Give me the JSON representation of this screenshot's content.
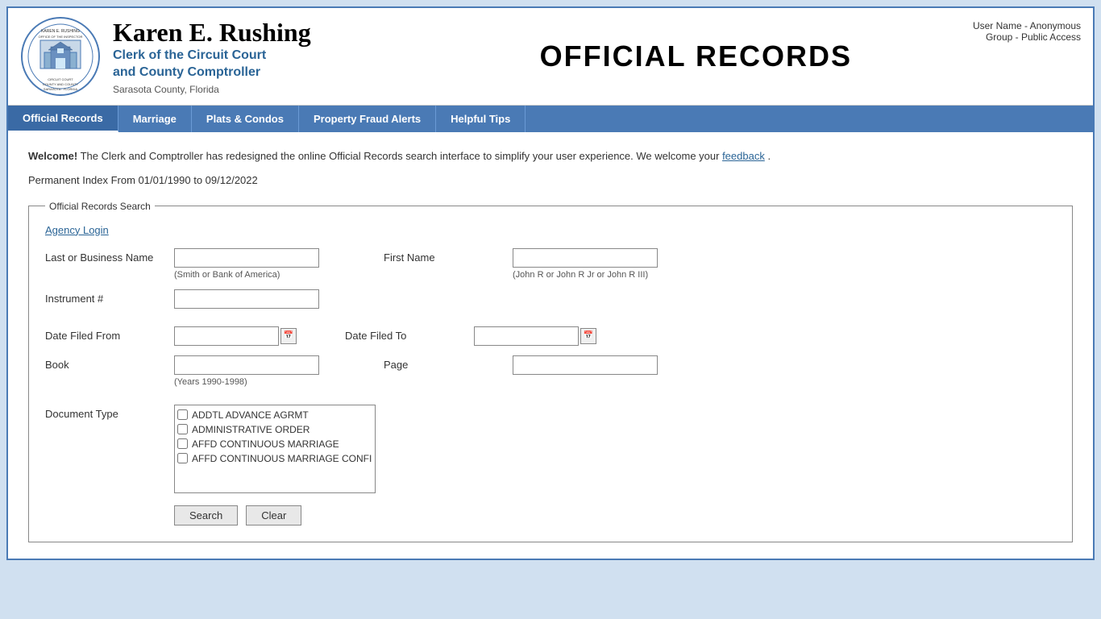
{
  "header": {
    "name": "Karen E. Rushing",
    "subtitle_line1": "Clerk of the Circuit Court",
    "subtitle_line2": "and County Comptroller",
    "county": "Sarasota County, Florida",
    "page_title": "OFFICIAL RECORDS",
    "user_line1": "User Name - Anonymous",
    "user_line2": "Group - Public Access"
  },
  "nav": {
    "items": [
      {
        "label": "Official Records",
        "active": true
      },
      {
        "label": "Marriage",
        "active": false
      },
      {
        "label": "Plats & Condos",
        "active": false
      },
      {
        "label": "Property Fraud Alerts",
        "active": false
      },
      {
        "label": "Helpful Tips",
        "active": false
      }
    ]
  },
  "content": {
    "welcome_bold": "Welcome!",
    "welcome_text": " The Clerk and Comptroller has redesigned the online Official Records search interface to simplify your user experience. We welcome your ",
    "feedback_link": "feedback",
    "welcome_end": ".",
    "permanent_index": "Permanent Index From 01/01/1990 to 09/12/2022",
    "search_legend": "Official Records Search",
    "agency_login": "Agency Login",
    "fields": {
      "last_business_name_label": "Last or Business Name",
      "last_business_name_hint": "(Smith or Bank of America)",
      "first_name_label": "First Name",
      "first_name_hint": "(John R or John R Jr or John R III)",
      "instrument_label": "Instrument #",
      "date_filed_from_label": "Date Filed From",
      "date_filed_to_label": "Date Filed To",
      "book_label": "Book",
      "book_hint": "(Years 1990-1998)",
      "page_label": "Page",
      "document_type_label": "Document Type"
    },
    "document_types": [
      "ADDTL ADVANCE AGRMT",
      "ADMINISTRATIVE ORDER",
      "AFFD CONTINUOUS MARRIAGE",
      "AFFD CONTINUOUS MARRIAGE CONFI"
    ],
    "buttons": {
      "search": "Search",
      "clear": "Clear"
    }
  }
}
